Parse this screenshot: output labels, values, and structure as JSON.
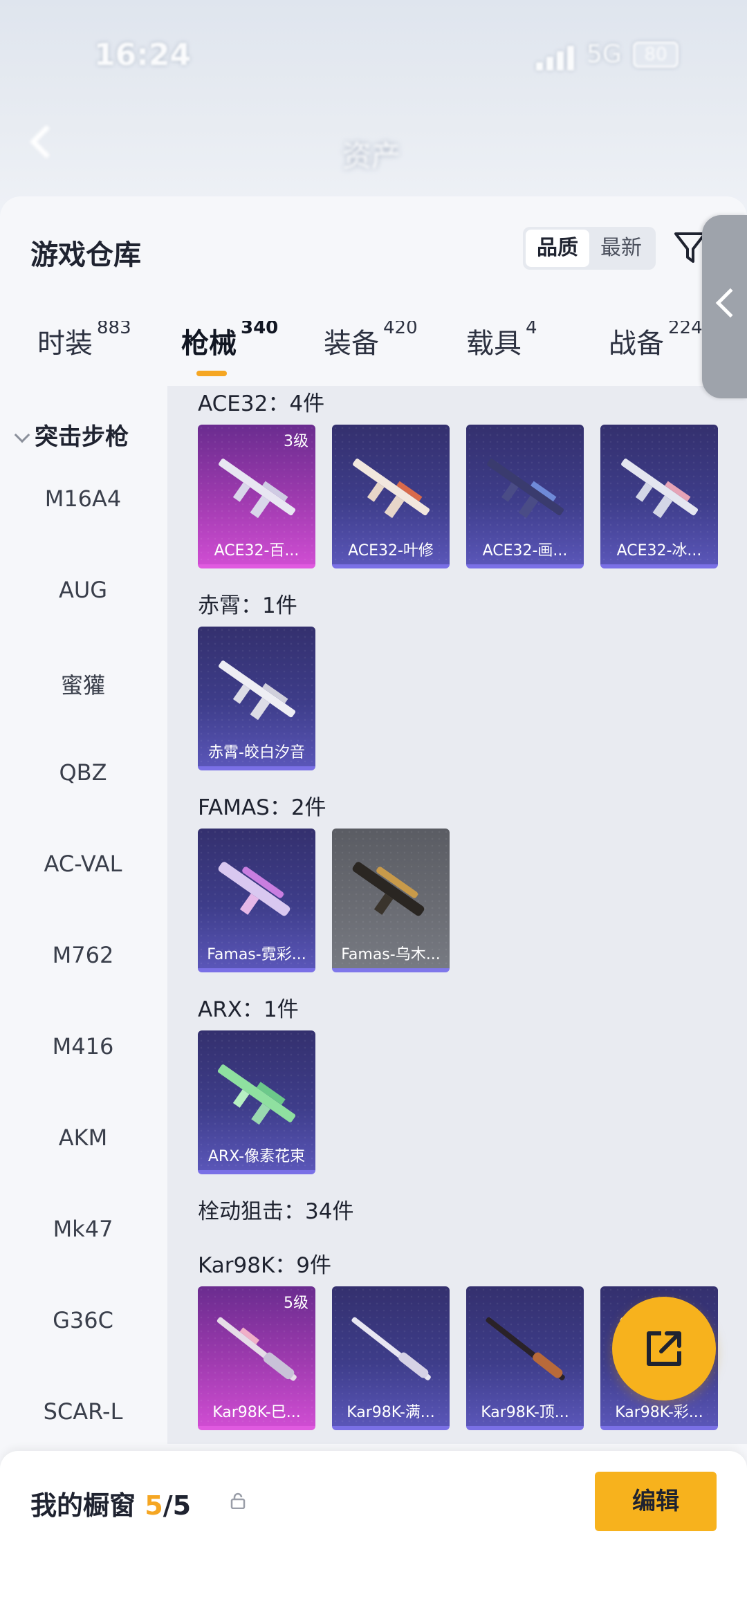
{
  "status_bar": {
    "time": "16:24",
    "network": "5G",
    "battery": "80"
  },
  "nav": {
    "title": "资产"
  },
  "header": {
    "title": "游戏仓库",
    "sort_options": [
      "品质",
      "最新"
    ],
    "active_sort": "品质"
  },
  "category_tabs": [
    {
      "label": "时装",
      "count": "883"
    },
    {
      "label": "枪械",
      "count": "340",
      "active": true
    },
    {
      "label": "装备",
      "count": "420"
    },
    {
      "label": "载具",
      "count": "4"
    },
    {
      "label": "战备",
      "count": "224"
    }
  ],
  "left_nav": {
    "group": "突击步枪",
    "items": [
      "M16A4",
      "AUG",
      "蜜獾",
      "QBZ",
      "AC-VAL",
      "M762",
      "M416",
      "AKM",
      "Mk47",
      "G36C",
      "SCAR-L"
    ]
  },
  "sections": [
    {
      "label": "ACE32：4件",
      "items": [
        {
          "name": "ACE32-百...",
          "tier": "3级",
          "color": "purple"
        },
        {
          "name": "ACE32-叶修",
          "color": "blue"
        },
        {
          "name": "ACE32-画...",
          "color": "blue"
        },
        {
          "name": "ACE32-冰...",
          "color": "blue"
        }
      ]
    },
    {
      "label": "赤霄：1件",
      "items": [
        {
          "name": "赤霄-皎白汐音",
          "color": "blue"
        }
      ]
    },
    {
      "label": "FAMAS：2件",
      "items": [
        {
          "name": "Famas-霓彩...",
          "color": "blue"
        },
        {
          "name": "Famas-乌木...",
          "color": "gray"
        }
      ]
    },
    {
      "label": "ARX：1件",
      "items": [
        {
          "name": "ARX-像素花束",
          "color": "blue"
        }
      ]
    },
    {
      "label": "栓动狙击：34件",
      "items": []
    },
    {
      "label": "Kar98K：9件",
      "items": [
        {
          "name": "Kar98K-巳...",
          "tier": "5级",
          "color": "purple"
        },
        {
          "name": "Kar98K-满...",
          "color": "blue"
        },
        {
          "name": "Kar98K-顶...",
          "color": "blue"
        },
        {
          "name": "Kar98K-彩...",
          "color": "blue"
        }
      ]
    }
  ],
  "bottom_bar": {
    "title": "我的橱窗",
    "count_current": "5",
    "count_sep": "/",
    "count_total": "5",
    "edit_label": "编辑"
  },
  "colors": {
    "accent": "#f7b21d",
    "purple_card": "#a03bb0",
    "blue_card": "#3e3d8a"
  },
  "icons": {
    "back": "chevron-left-icon",
    "filter": "funnel-icon",
    "share": "external-link-icon",
    "lock": "lock-icon",
    "collapse": "chevron-left-icon"
  }
}
